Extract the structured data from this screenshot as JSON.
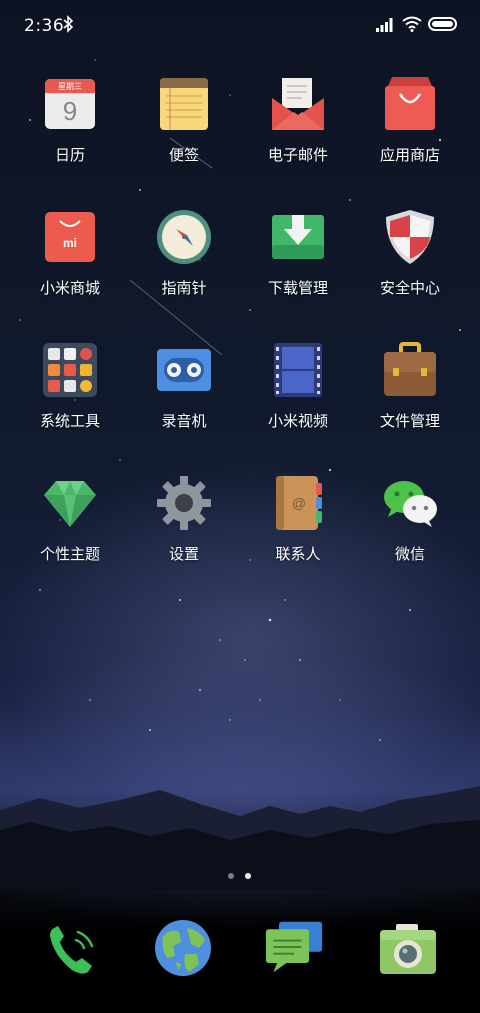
{
  "status_bar": {
    "time": "2:36",
    "icons": [
      "bluetooth-icon",
      "signal-icon",
      "wifi-icon",
      "battery-icon"
    ]
  },
  "apps": [
    {
      "label": "日历",
      "icon": "calendar-icon",
      "detail": "星期三",
      "day": "9"
    },
    {
      "label": "便签",
      "icon": "notes-icon"
    },
    {
      "label": "电子邮件",
      "icon": "email-icon"
    },
    {
      "label": "应用商店",
      "icon": "app-store-icon"
    },
    {
      "label": "小米商城",
      "icon": "mi-store-icon",
      "detail": "mi"
    },
    {
      "label": "指南针",
      "icon": "compass-icon"
    },
    {
      "label": "下载管理",
      "icon": "download-icon"
    },
    {
      "label": "安全中心",
      "icon": "security-shield-icon"
    },
    {
      "label": "系统工具",
      "icon": "system-tools-folder-icon"
    },
    {
      "label": "录音机",
      "icon": "recorder-icon"
    },
    {
      "label": "小米视频",
      "icon": "video-icon"
    },
    {
      "label": "文件管理",
      "icon": "file-manager-icon"
    },
    {
      "label": "个性主题",
      "icon": "themes-icon"
    },
    {
      "label": "设置",
      "icon": "settings-gear-icon"
    },
    {
      "label": "联系人",
      "icon": "contacts-icon",
      "detail": "@"
    },
    {
      "label": "微信",
      "icon": "wechat-icon"
    }
  ],
  "pager": {
    "pages": 2,
    "active": 2
  },
  "dock": [
    {
      "icon": "phone-icon"
    },
    {
      "icon": "browser-globe-icon"
    },
    {
      "icon": "messages-icon"
    },
    {
      "icon": "camera-icon"
    }
  ],
  "colors": {
    "text": "#ffffff",
    "pager_active": "#ffffff",
    "pager_inactive": "#7a7f8c"
  }
}
